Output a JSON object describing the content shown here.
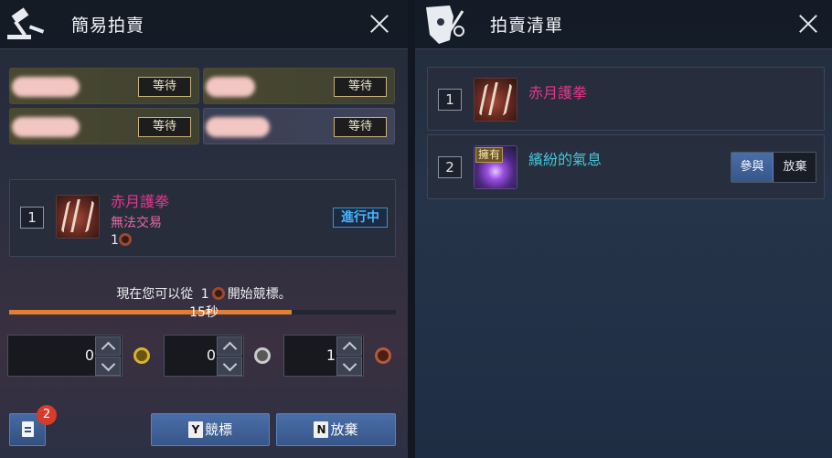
{
  "left": {
    "title": "簡易拍賣",
    "slots": [
      {
        "status": "等待"
      },
      {
        "status": "等待"
      },
      {
        "status": "等待"
      },
      {
        "status": "等待"
      }
    ],
    "item": {
      "index": "1",
      "name": "赤月護拳",
      "trade": "無法交易",
      "qty": "1",
      "status": "進行中"
    },
    "prompt": {
      "before": "現在您可以從",
      "amount": "1",
      "after": "開始競標。"
    },
    "timer": "15秒",
    "progress_fraction": 0.73,
    "bid_fields": {
      "gold": "0",
      "silver": "0",
      "bronze": "1"
    },
    "notify_count": "2",
    "bid_button": {
      "key": "Y",
      "label": "競標"
    },
    "pass_button": {
      "key": "N",
      "label": "放棄"
    }
  },
  "right": {
    "title": "拍賣清單",
    "items": [
      {
        "index": "1",
        "name": "赤月護拳"
      },
      {
        "index": "2",
        "name": "繽紛的氣息",
        "badge": "擁有",
        "join": "參與",
        "giveup": "放棄"
      }
    ]
  },
  "colors": {
    "pink": "#e4378d",
    "cyan": "#49c3d9",
    "accent": "#46b6ff",
    "progress": "#e07e35"
  }
}
